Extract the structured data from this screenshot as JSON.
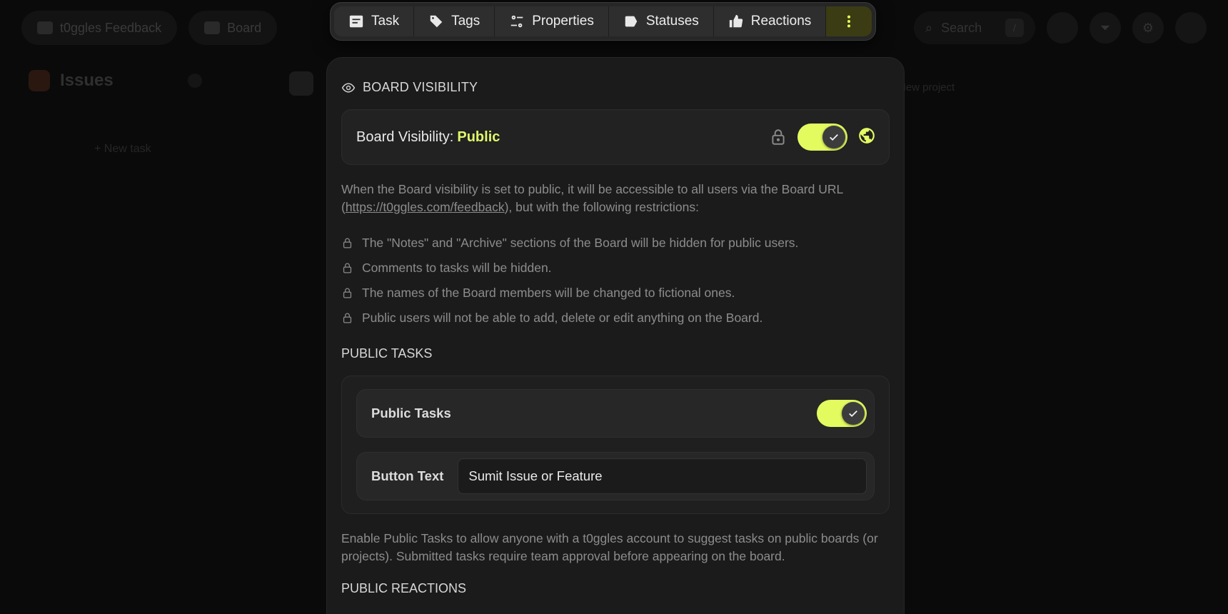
{
  "background": {
    "board_name": "t0ggles Feedback",
    "view_label": "Board",
    "search_placeholder": "Search",
    "search_shortcut": "/",
    "column_title": "Issues",
    "new_task": "New task",
    "new_project": "New project"
  },
  "toolbar": {
    "items": [
      {
        "label": "Task",
        "icon": "task-icon"
      },
      {
        "label": "Tags",
        "icon": "tag-icon"
      },
      {
        "label": "Properties",
        "icon": "properties-icon"
      },
      {
        "label": "Statuses",
        "icon": "status-label-icon"
      },
      {
        "label": "Reactions",
        "icon": "thumbs-up-icon"
      }
    ],
    "more_icon": "more-vertical-icon",
    "accent": "#e5ff57"
  },
  "board_visibility": {
    "heading": "BOARD VISIBILITY",
    "label": "Board Visibility:",
    "value": "Public",
    "toggle_on": true,
    "description_pre": "When the Board visibility is set to public, it will be accessible to all users via the Board URL (",
    "url": "https://t0ggles.com/feedback",
    "description_post": "), but with the following restrictions:",
    "restrictions": [
      "The \"Notes\" and \"Archive\" sections of the Board will be hidden for public users.",
      "Comments to tasks will be hidden.",
      "The names of the Board members will be changed to fictional ones.",
      "Public users will not be able to add, delete or edit anything on the Board."
    ]
  },
  "public_tasks": {
    "heading": "PUBLIC TASKS",
    "toggle_label": "Public Tasks",
    "toggle_on": true,
    "button_text_label": "Button Text",
    "button_text_value": "Sumit Issue or Feature",
    "description": "Enable Public Tasks to allow anyone with a t0ggles account to suggest tasks on public boards (or projects). Submitted tasks require team approval before appearing on the board."
  },
  "public_reactions": {
    "heading": "PUBLIC REACTIONS"
  }
}
